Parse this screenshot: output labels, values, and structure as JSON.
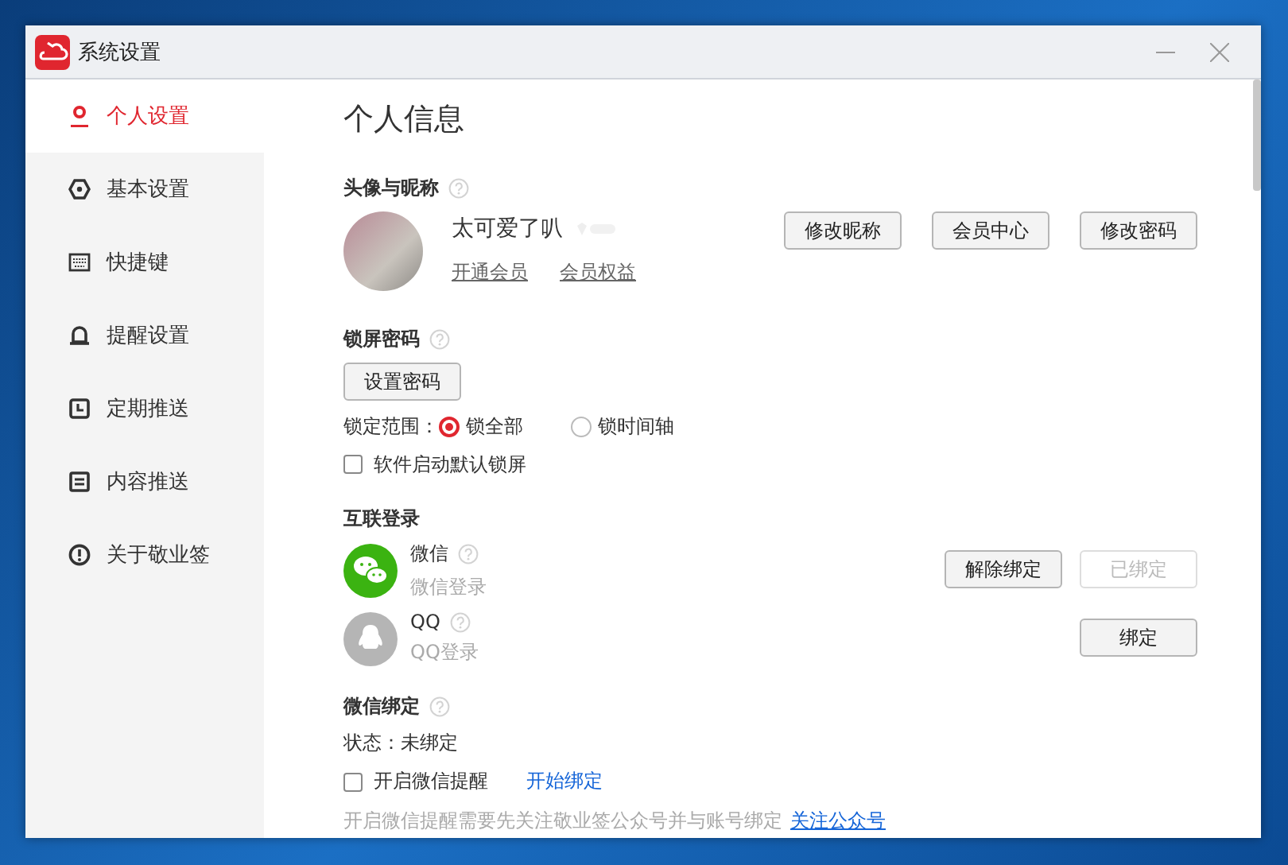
{
  "window": {
    "title": "系统设置"
  },
  "sidebar": {
    "items": [
      {
        "kind": "person",
        "label": "个人设置",
        "selected": true
      },
      {
        "kind": "hexagon",
        "label": "基本设置",
        "selected": false
      },
      {
        "kind": "keyboard",
        "label": "快捷键",
        "selected": false
      },
      {
        "kind": "bell",
        "label": "提醒设置",
        "selected": false
      },
      {
        "kind": "clock",
        "label": "定期推送",
        "selected": false
      },
      {
        "kind": "doc",
        "label": "内容推送",
        "selected": false
      },
      {
        "kind": "info",
        "label": "关于敬业签",
        "selected": false
      }
    ]
  },
  "page_title": "个人信息",
  "profile": {
    "heading": "头像与昵称",
    "nickname": "太可爱了叭",
    "links": [
      "开通会员",
      "会员权益"
    ],
    "buttons": [
      "修改昵称",
      "会员中心",
      "修改密码"
    ]
  },
  "lock": {
    "heading": "锁屏密码",
    "button": "设置密码",
    "scope_label": "锁定范围：",
    "options": [
      {
        "label": "锁全部",
        "selected": true
      },
      {
        "label": "锁时间轴",
        "selected": false
      }
    ],
    "checkbox": {
      "label": "软件启动默认锁屏",
      "checked": false
    }
  },
  "linked_login": {
    "heading": "互联登录",
    "accounts": [
      {
        "kind": "wechat",
        "name": "微信",
        "subtitle": "微信登录",
        "buttons": [
          {
            "label": "解除绑定",
            "disabled": false
          },
          {
            "label": "已绑定",
            "disabled": true
          }
        ]
      },
      {
        "kind": "qq",
        "name": "QQ",
        "subtitle": "QQ登录",
        "buttons": [
          {
            "label": "绑定",
            "disabled": false
          }
        ]
      }
    ]
  },
  "wechat_binding": {
    "heading": "微信绑定",
    "status": "状态：未绑定",
    "checkbox": {
      "label": "开启微信提醒",
      "checked": false
    },
    "link": "开始绑定",
    "note": "开启微信提醒需要先关注敬业签公众号并与账号绑定",
    "note_link": "关注公众号"
  }
}
